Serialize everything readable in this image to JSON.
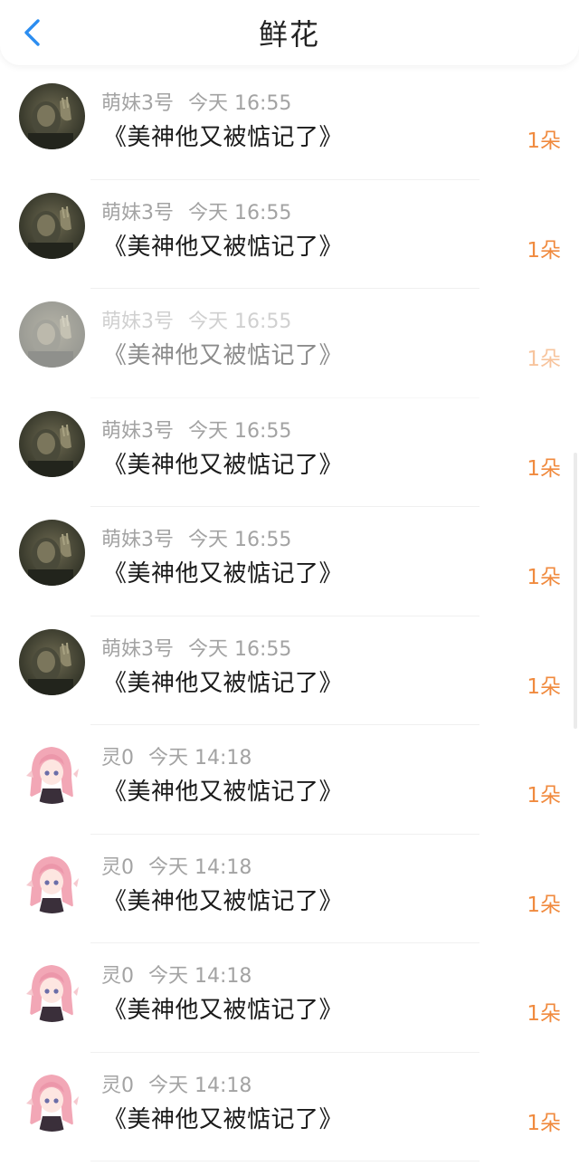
{
  "header": {
    "title": "鲜花",
    "back_icon": "chevron-left-icon",
    "accent_color": "#2c8df0"
  },
  "colors": {
    "username": "#a3a3a3",
    "count": "#f08a3e"
  },
  "list": [
    {
      "user": "萌妹3号",
      "time": "今天 16:55",
      "message": "《美神他又被惦记了》",
      "count": "1朵",
      "avatar": "dark-portrait-avatar",
      "faded": false
    },
    {
      "user": "萌妹3号",
      "time": "今天 16:55",
      "message": "《美神他又被惦记了》",
      "count": "1朵",
      "avatar": "dark-portrait-avatar",
      "faded": false
    },
    {
      "user": "萌妹3号",
      "time": "今天 16:55",
      "message": "《美神他又被惦记了》",
      "count": "1朵",
      "avatar": "dark-portrait-avatar",
      "faded": true
    },
    {
      "user": "萌妹3号",
      "time": "今天 16:55",
      "message": "《美神他又被惦记了》",
      "count": "1朵",
      "avatar": "dark-portrait-avatar",
      "faded": false
    },
    {
      "user": "萌妹3号",
      "time": "今天 16:55",
      "message": "《美神他又被惦记了》",
      "count": "1朵",
      "avatar": "dark-portrait-avatar",
      "faded": false
    },
    {
      "user": "萌妹3号",
      "time": "今天 16:55",
      "message": "《美神他又被惦记了》",
      "count": "1朵",
      "avatar": "dark-portrait-avatar",
      "faded": false
    },
    {
      "user": "灵0",
      "time": "今天 14:18",
      "message": "《美神他又被惦记了》",
      "count": "1朵",
      "avatar": "anime-girl-avatar",
      "faded": false
    },
    {
      "user": "灵0",
      "time": "今天 14:18",
      "message": "《美神他又被惦记了》",
      "count": "1朵",
      "avatar": "anime-girl-avatar",
      "faded": false
    },
    {
      "user": "灵0",
      "time": "今天 14:18",
      "message": "《美神他又被惦记了》",
      "count": "1朵",
      "avatar": "anime-girl-avatar",
      "faded": false
    },
    {
      "user": "灵0",
      "time": "今天 14:18",
      "message": "《美神他又被惦记了》",
      "count": "1朵",
      "avatar": "anime-girl-avatar",
      "faded": false
    }
  ]
}
